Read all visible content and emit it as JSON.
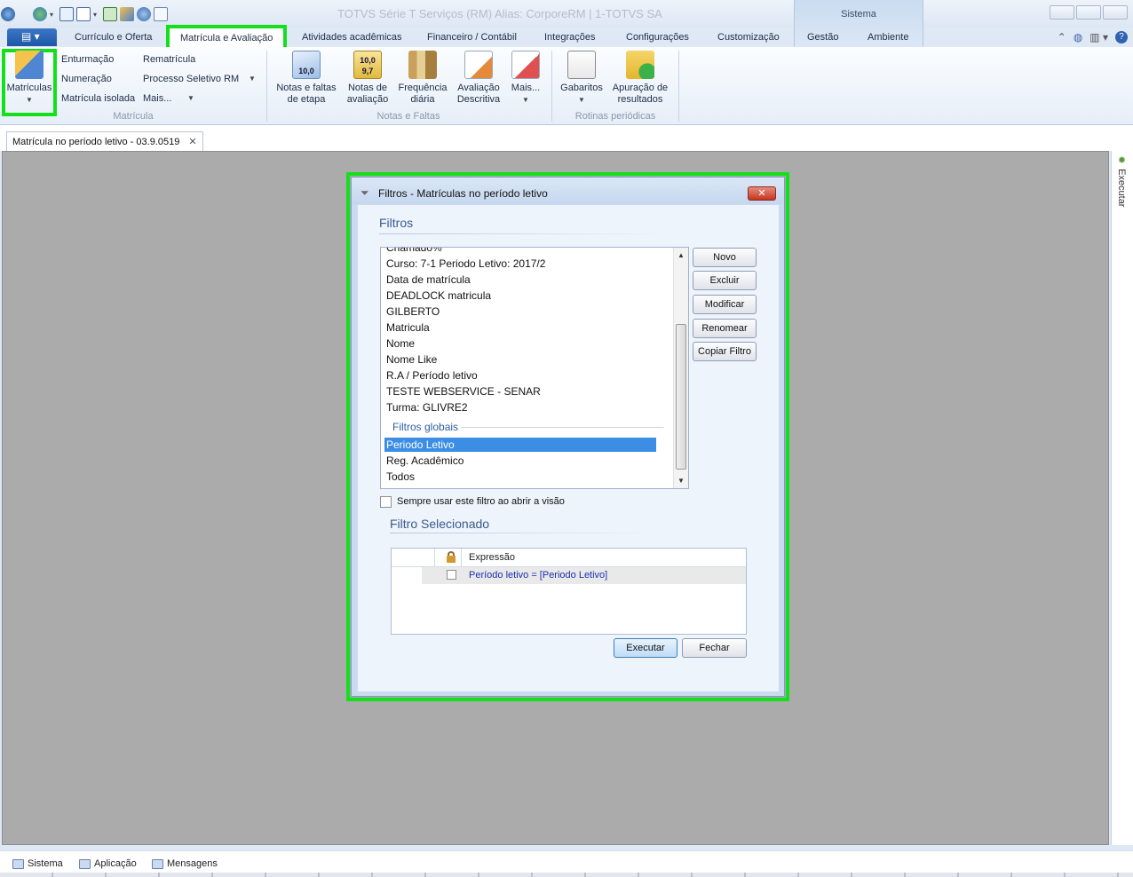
{
  "window": {
    "title": "TOTVS Série T Serviços (RM) Alias: CorporeRM | 1-TOTVS SA",
    "context_tab": "Sistema"
  },
  "ribbon": {
    "tabs": [
      {
        "label": "Currículo e Oferta"
      },
      {
        "label": "Matrícula e Avaliação"
      },
      {
        "label": "Atividades acadêmicas"
      },
      {
        "label": "Financeiro / Contábil"
      },
      {
        "label": "Integrações"
      },
      {
        "label": "Configurações"
      },
      {
        "label": "Customização"
      },
      {
        "label": "Gestão"
      },
      {
        "label": "Ambiente"
      }
    ],
    "matricula_group": {
      "label": "Matrícula",
      "big_button": "Matrículas",
      "col1": [
        "Enturmação",
        "Numeração",
        "Matrícula isolada"
      ],
      "col2": [
        "Rematrícula",
        "Processo Seletivo RM",
        "Mais..."
      ]
    },
    "notas_group": {
      "label": "Notas e Faltas",
      "buttons": [
        {
          "line1": "Notas e faltas",
          "line2": "de etapa",
          "icon_value": "10,0"
        },
        {
          "line1": "Notas de",
          "line2": "avaliação",
          "icon_value": "10,0 9,7"
        },
        {
          "line1": "Frequência",
          "line2": "diária"
        },
        {
          "line1": "Avaliação",
          "line2": "Descritiva"
        },
        {
          "line1": "Mais...",
          "line2": ""
        }
      ]
    },
    "rotinas_group": {
      "label": "Rotinas periódicas",
      "buttons": [
        {
          "line1": "Gabaritos",
          "line2": ""
        },
        {
          "line1": "Apuração de",
          "line2": "resultados"
        }
      ]
    }
  },
  "document_tab": {
    "label": "Matrícula no período letivo - 03.9.0519",
    "close": "✕"
  },
  "side_panel": {
    "label": "Executar"
  },
  "dialog": {
    "title": "Filtros - Matrículas no período letivo",
    "close": "✕",
    "filters_heading": "Filtros",
    "filters_list": [
      "Chamado%",
      "Curso: 7-1 Periodo Letivo: 2017/2",
      "Data de matrícula",
      "DEADLOCK matricula",
      "GILBERTO",
      "Matricula",
      "Nome",
      "Nome Like",
      "R.A / Período letivo",
      "TESTE WEBSERVICE - SENAR",
      "Turma: GLIVRE2"
    ],
    "global_heading": "Filtros globais",
    "global_list": [
      "Periodo Letivo",
      "Reg. Acadêmico",
      "Todos"
    ],
    "buttons": {
      "novo": "Novo",
      "excluir": "Excluir",
      "modificar": "Modificar",
      "renomear": "Renomear",
      "copiar": "Copiar Filtro",
      "executar": "Executar",
      "fechar": "Fechar"
    },
    "always_use_label": "Sempre usar este filtro ao abrir a visão",
    "selected_heading": "Filtro Selecionado",
    "grid": {
      "column": "Expressão",
      "row": "Período letivo = [Periodo Letivo]"
    }
  },
  "statusbar": {
    "items": [
      "Sistema",
      "Aplicação",
      "Mensagens"
    ]
  },
  "colors": {
    "highlight": "#13e01a",
    "selection": "#3b8ee4",
    "expression": "#1a2fb0"
  }
}
